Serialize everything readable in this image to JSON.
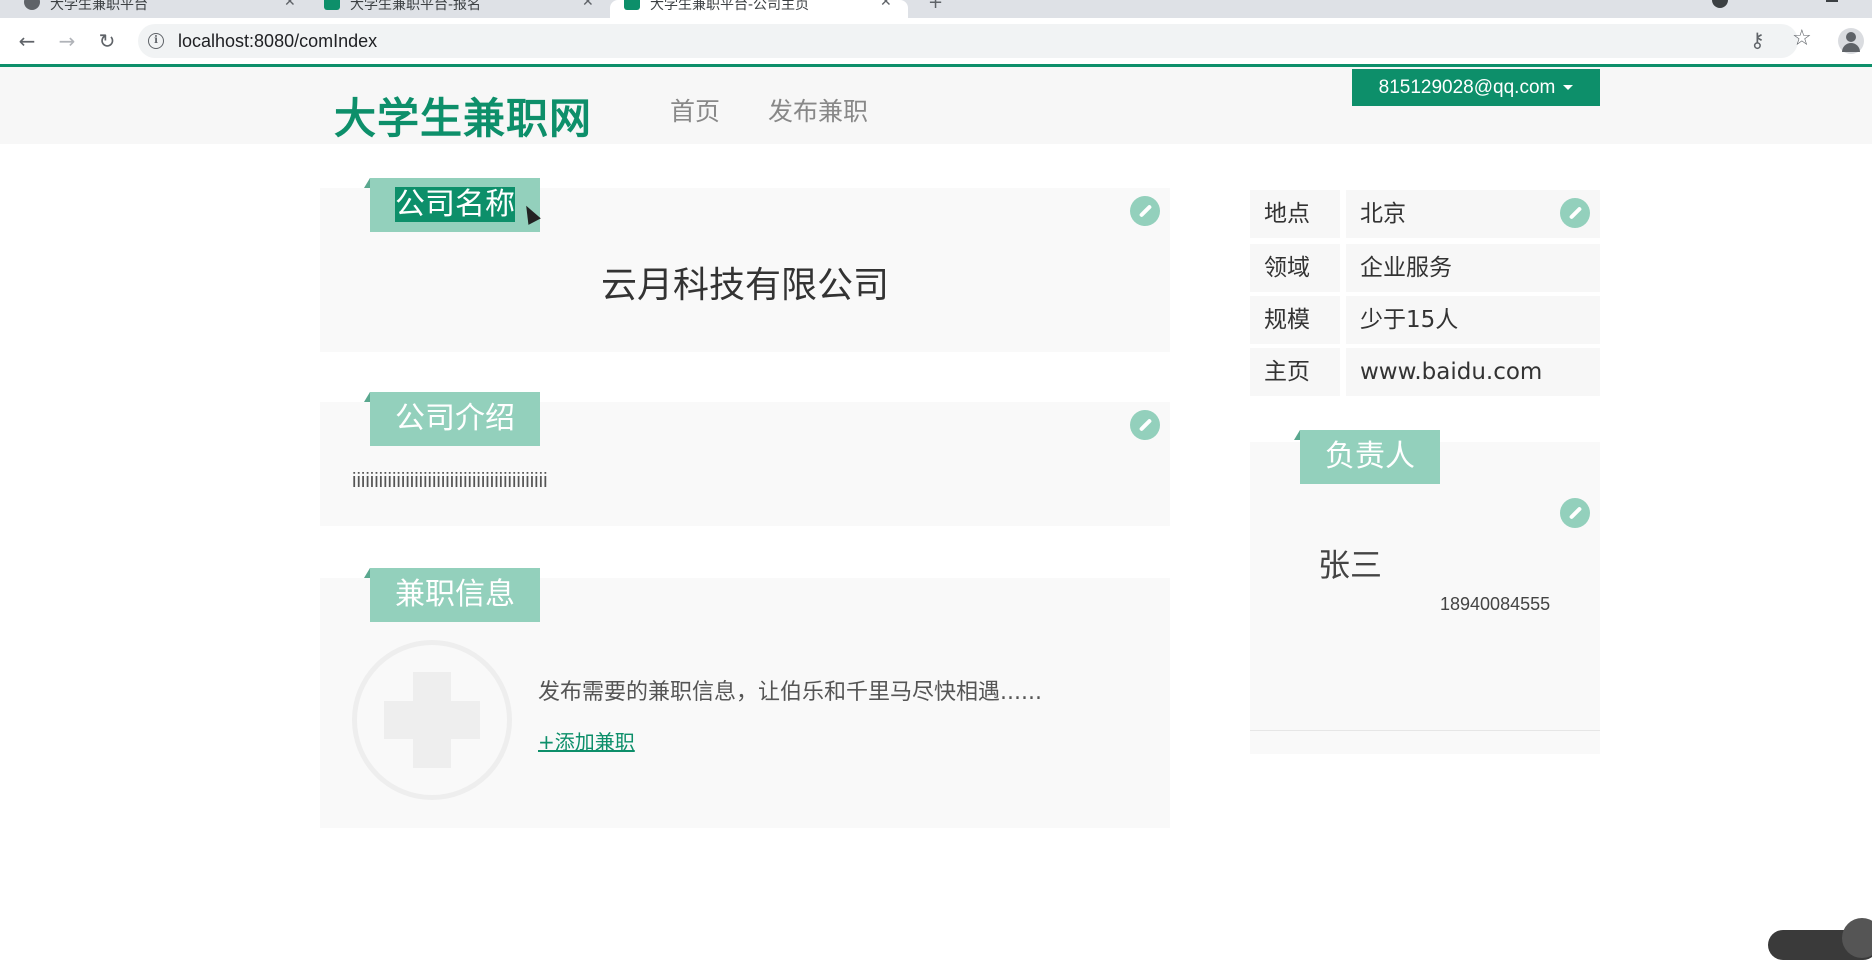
{
  "browser": {
    "tabs": [
      {
        "title": "大学生兼职平台",
        "active": false
      },
      {
        "title": "大学生兼职平台-报名",
        "active": false
      },
      {
        "title": "大学生兼职平台-公司主页",
        "active": true
      }
    ],
    "url": "localhost:8080/comIndex",
    "icons": {
      "back": "back-arrow-icon",
      "forward": "forward-arrow-icon",
      "reload": "reload-icon",
      "key": "key-icon",
      "star": "star-icon",
      "profile": "profile-icon"
    }
  },
  "header": {
    "logo": "大学生兼职网",
    "nav": [
      "首页",
      "发布兼职"
    ],
    "user_email": "815129028@qq.com",
    "brand_color": "#0d8f6a"
  },
  "company_name_panel": {
    "tag": "公司名称",
    "name": "云月科技有限公司"
  },
  "intro_panel": {
    "tag": "公司介绍",
    "text": "iiiiiiiiiiiiiiiiiiiiiiiiiiiiiiiiiiiiiiiiiiii"
  },
  "jobs_panel": {
    "tag": "兼职信息",
    "text": "发布需要的兼职信息，让伯乐和千里马尽快相遇......",
    "add_link": "+添加兼职"
  },
  "info": [
    {
      "key": "地点",
      "value": "北京"
    },
    {
      "key": "领域",
      "value": "企业服务"
    },
    {
      "key": "规模",
      "value": "少于15人"
    },
    {
      "key": "主页",
      "value": "www.baidu.com"
    }
  ],
  "contact_panel": {
    "tag": "负责人",
    "name": "张三",
    "phone": "18940084555"
  }
}
